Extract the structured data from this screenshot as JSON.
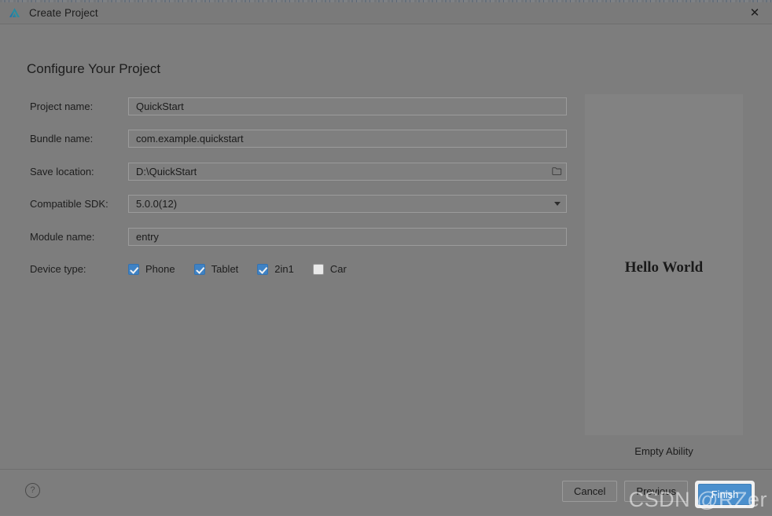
{
  "window": {
    "title": "Create Project",
    "logo_icon": "deveco-logo-icon",
    "close_icon": "close-icon"
  },
  "page": {
    "heading": "Configure Your Project"
  },
  "form": {
    "fields": [
      {
        "label": "Project name:",
        "value": "QuickStart",
        "type": "text"
      },
      {
        "label": "Bundle name:",
        "value": "com.example.quickstart",
        "type": "text"
      },
      {
        "label": "Save location:",
        "value": "D:\\QuickStart",
        "type": "text-with-browse",
        "button_icon": "folder-icon"
      },
      {
        "label": "Compatible SDK:",
        "value": "5.0.0(12)",
        "type": "select",
        "button_icon": "chevron-down-icon"
      },
      {
        "label": "Module name:",
        "value": "entry",
        "type": "text"
      }
    ],
    "device_type": {
      "label": "Device type:",
      "options": [
        {
          "label": "Phone",
          "checked": true
        },
        {
          "label": "Tablet",
          "checked": true
        },
        {
          "label": "2in1",
          "checked": true
        },
        {
          "label": "Car",
          "checked": false
        }
      ]
    }
  },
  "preview": {
    "screen_text": "Hello World",
    "caption": "Empty Ability"
  },
  "footer": {
    "help_icon_label": "?",
    "cancel_label": "Cancel",
    "previous_label": "Previous",
    "finish_label": "Finish"
  },
  "watermark": {
    "text": "CSDN @RZer"
  },
  "colors": {
    "accent": "#4a8fcd",
    "checkbox_checked": "#3f82c4",
    "dialog_bg": "#7d7d7d",
    "preview_bg": "#828282"
  }
}
